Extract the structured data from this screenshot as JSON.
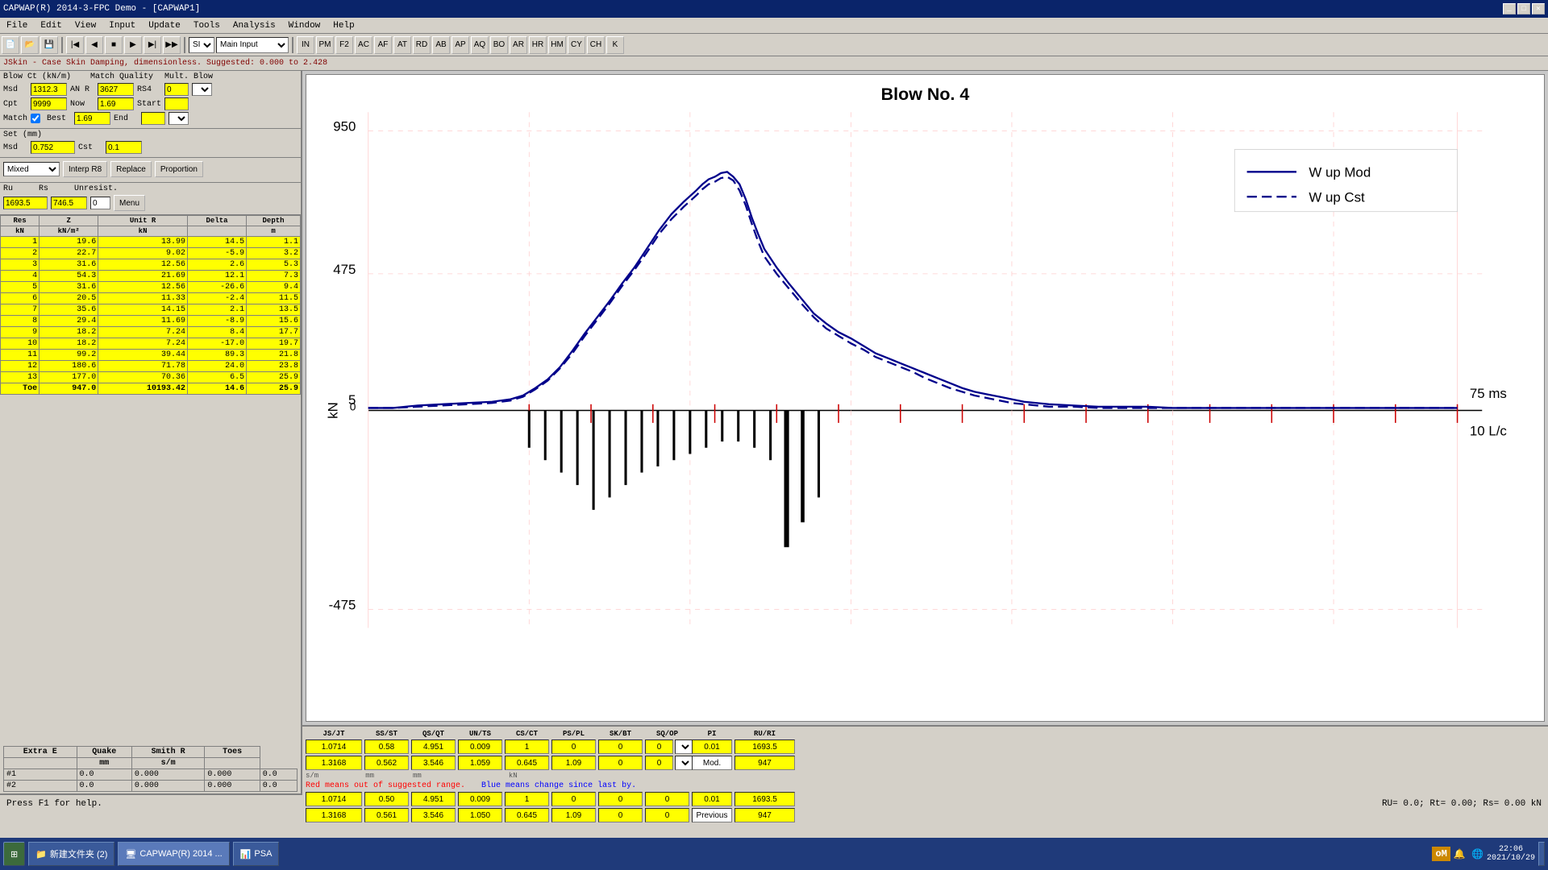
{
  "title_bar": {
    "text": "CAPWAP(R) 2014-3-FPC Demo      - [CAPWAP1]",
    "app_name": "CAPWAP(R) 2014-3-FPC Demo"
  },
  "menu": {
    "items": [
      "File",
      "Edit",
      "View",
      "Input",
      "Update",
      "Tools",
      "Analysis",
      "Window",
      "Help"
    ]
  },
  "toolbar": {
    "si_label": "SI",
    "main_input_label": "Main Input"
  },
  "info_bar": {
    "text": "JSkin - Case Skin Damping, dimensionless. Suggested: 0.000 to 2.428"
  },
  "left_panel": {
    "blow_section": {
      "title": "Blow Ct (kN/m)",
      "msd_label": "Msd",
      "msd_value": "1312.3",
      "match_quality_label": "Match Quality",
      "an_r_label": "AN R",
      "an_r_value": "3627",
      "rs4_label": "RS4",
      "rs4_value": "0",
      "cpt_label": "Cpt",
      "cpt_value": "9999",
      "now_label": "Now",
      "now_value": "1.69",
      "start_label": "Start",
      "end_label": "End",
      "match_label": "Match",
      "best_label": "Best",
      "best_value": "1.69"
    },
    "set_section": {
      "title": "Set (mm)",
      "msd_label": "Msd",
      "msd_value": "0.752",
      "cst_label": "Cst",
      "cst_value": "0.1"
    },
    "mode_section": {
      "mode_value": "Mixed",
      "interp_r8_label": "Interp R8",
      "replace_label": "Replace",
      "proportion_label": "Proportion"
    },
    "ru_section": {
      "ru_label": "Ru",
      "rs_label": "Rs",
      "unresist_label": "Unresist.",
      "ru_value": "1693.5",
      "rs_value": "746.5",
      "unresist_value": "0",
      "menu_btn": "Menu"
    },
    "table": {
      "headers": [
        "Res",
        "Z",
        "Unit R",
        "Delta",
        "Depth"
      ],
      "subheaders": [
        "kN",
        "kN/m^2",
        "kN",
        "m"
      ],
      "rows": [
        {
          "res": "1",
          "z": "19.6",
          "unit_r": "13.99",
          "delta": "14.5",
          "depth": "1.1"
        },
        {
          "res": "2",
          "z": "22.7",
          "unit_r": "9.02",
          "delta": "-5.9",
          "depth": "3.2"
        },
        {
          "res": "3",
          "z": "31.6",
          "unit_r": "12.56",
          "delta": "2.6",
          "depth": "5.3"
        },
        {
          "res": "4",
          "z": "54.3",
          "unit_r": "21.69",
          "delta": "12.1",
          "depth": "7.3"
        },
        {
          "res": "5",
          "z": "31.6",
          "unit_r": "12.56",
          "delta": "-26.6",
          "depth": "9.4"
        },
        {
          "res": "6",
          "z": "20.5",
          "unit_r": "11.33",
          "delta": "-2.4",
          "depth": "11.5"
        },
        {
          "res": "7",
          "z": "35.6",
          "unit_r": "14.15",
          "delta": "2.1",
          "depth": "13.5"
        },
        {
          "res": "8",
          "z": "29.4",
          "unit_r": "11.69",
          "delta": "-8.9",
          "depth": "15.6"
        },
        {
          "res": "9",
          "z": "18.2",
          "unit_r": "7.24",
          "delta": "8.4",
          "depth": "17.7"
        },
        {
          "res": "10",
          "z": "18.2",
          "unit_r": "7.24",
          "delta": "-17.0",
          "depth": "19.7"
        },
        {
          "res": "11",
          "z": "99.2",
          "unit_r": "39.44",
          "delta": "89.3",
          "depth": "21.8"
        },
        {
          "res": "12",
          "z": "180.6",
          "unit_r": "71.78",
          "delta": "24.0",
          "depth": "23.8"
        },
        {
          "res": "13",
          "z": "177.0",
          "unit_r": "70.36",
          "delta": "6.5",
          "depth": "25.9"
        },
        {
          "res": "Toe",
          "z": "947.0",
          "unit_r": "10193.42",
          "delta": "14.6",
          "depth": "25.9"
        }
      ]
    },
    "extra_section": {
      "title": "Extra E",
      "quake_label": "Quake",
      "smith_r_label": "Smith R",
      "toes_label": "Toes",
      "mm_label": "mm",
      "sm_label": "s/m",
      "rows": [
        {
          "id": "#1",
          "extra_e": "0.0",
          "quake": "0.000",
          "smith_r": "0.000",
          "toes": "0.0"
        },
        {
          "id": "#2",
          "extra_e": "0.0",
          "quake": "0.000",
          "smith_r": "0.000",
          "toes": "0.0"
        }
      ]
    }
  },
  "chart": {
    "title": "Blow No. 4",
    "y_max": "950",
    "y_mid": "475",
    "y_zero": "0",
    "y_neg": "-475",
    "y_unit": "kN",
    "x_right1": "75 ms",
    "x_right2": "10 L/c",
    "legend": [
      {
        "label": "W up Mod",
        "style": "solid"
      },
      {
        "label": "W up Cst",
        "style": "dashed"
      }
    ]
  },
  "bottom_panel": {
    "col_headers": [
      "JS/JT",
      "SS/ST",
      "QS/QT",
      "UN/TS",
      "CS/CT",
      "PS/PL",
      "SK/BT",
      "SQ/QP",
      "PI",
      "RU/RI"
    ],
    "row1": {
      "values": [
        "1.0714",
        "0.58",
        "4.951",
        "0.009",
        "1",
        "0",
        "0",
        "0",
        "0.01",
        "1693.5"
      ]
    },
    "row2": {
      "values": [
        "1.3168",
        "0.562",
        "3.546",
        "1.059",
        "0.645",
        "1.09",
        "0",
        "0",
        "Mod.",
        "947"
      ]
    },
    "units_row": {
      "u1": "s/m",
      "u2": "mm",
      "u3": "mm",
      "u4": "kN"
    },
    "messages": {
      "red": "Red means out of suggested range.",
      "blue": "Blue means change since last by."
    },
    "row3": {
      "values": [
        "1.0714",
        "0.50",
        "4.951",
        "0.009",
        "1",
        "0",
        "0",
        "0",
        "0.01",
        "1693.5"
      ]
    },
    "row4": {
      "values": [
        "1.3168",
        "0.561",
        "3.546",
        "1.050",
        "0.645",
        "1.09",
        "0",
        "0",
        "Previous",
        "947"
      ]
    }
  },
  "status_bar": {
    "left": "Press F1 for help.",
    "right": "RU= 0.0; Rt= 0.00; Rs= 0.00 kN"
  },
  "taskbar": {
    "start_label": "⊞",
    "items": [
      {
        "label": "新建文件夹 (2)",
        "icon": "📁"
      },
      {
        "label": "CAPWAP(R) 2014 ...",
        "icon": "🖥"
      },
      {
        "label": "PSA",
        "icon": "📊"
      }
    ],
    "clock": "22:06",
    "date": "2021/10/29",
    "tray_icon": "oM"
  }
}
